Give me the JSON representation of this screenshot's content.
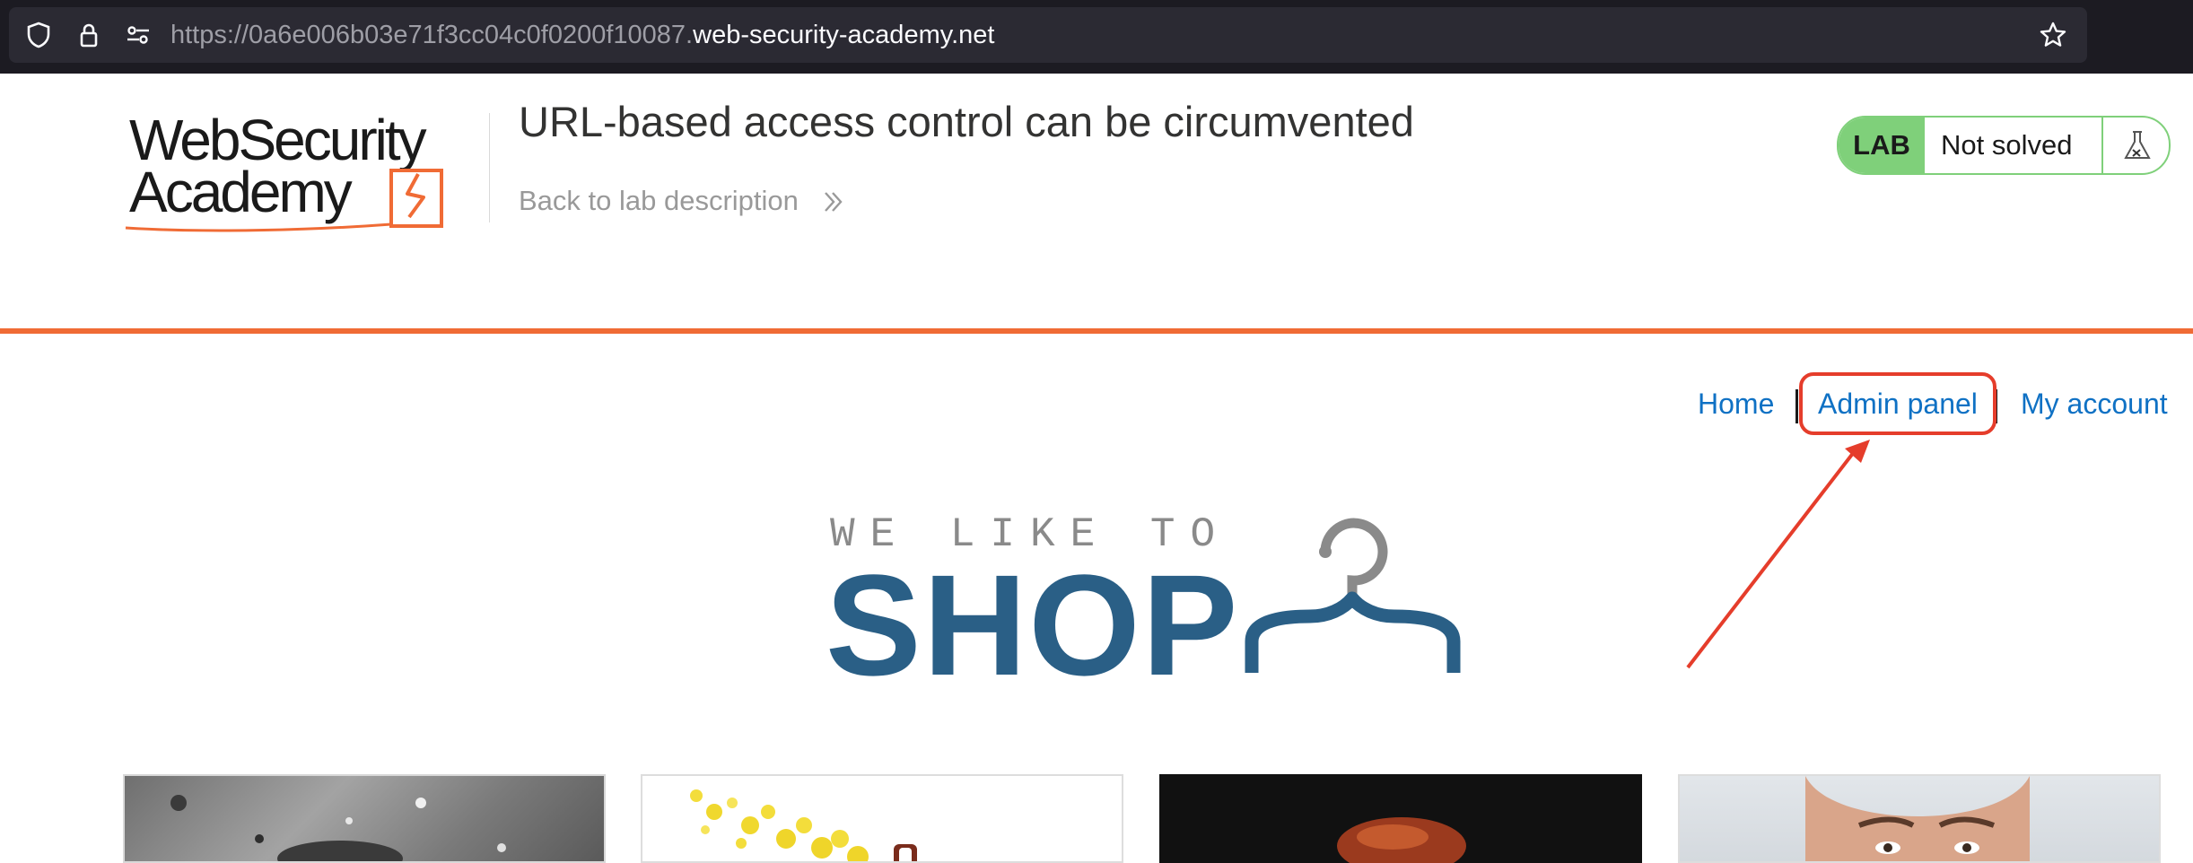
{
  "browser": {
    "url_prefix": "https://0a6e006b03e71f3cc04c0f0200f10087.",
    "url_host": "web-security-academy.net"
  },
  "header": {
    "logo_text_line1": "WebSecurity",
    "logo_text_line2": "Academy",
    "lab_title": "URL-based access control can be circumvented",
    "back_link": "Back to lab description",
    "lab_badge_label": "LAB",
    "lab_status": "Not solved"
  },
  "nav": {
    "home": "Home",
    "admin_panel": "Admin panel",
    "my_account": "My account"
  },
  "hero": {
    "tagline": "WE LIKE TO",
    "brand": "SHOP"
  },
  "colors": {
    "accent_orange": "#f06b35",
    "link_blue": "#0f71c4",
    "brand_blue": "#2a5f86",
    "lab_green": "#7fd07a",
    "annotation_red": "#e53d2b"
  },
  "products": [
    {
      "image": "water-splash-photo"
    },
    {
      "image": "yellow-particles-product"
    },
    {
      "image": "brown-object-on-black"
    },
    {
      "image": "man-face-photo"
    }
  ]
}
